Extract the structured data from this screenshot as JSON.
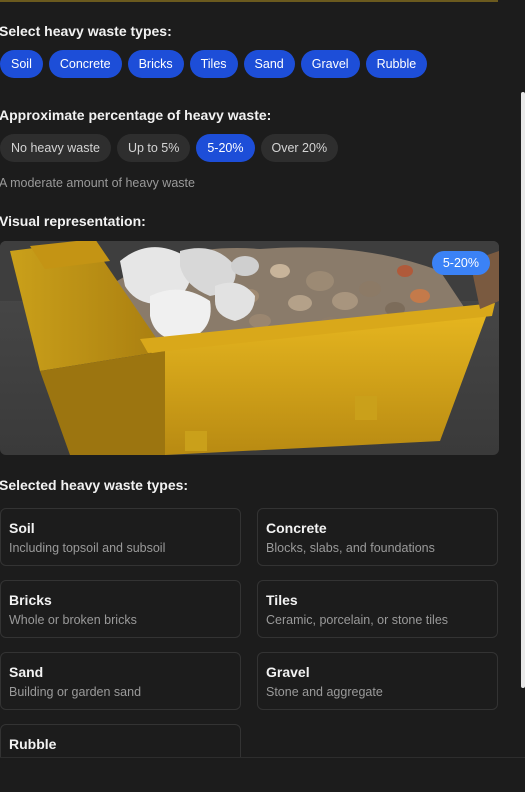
{
  "heavy_types_section": {
    "title": "Select heavy waste types:",
    "chips": [
      "Soil",
      "Concrete",
      "Bricks",
      "Tiles",
      "Sand",
      "Gravel",
      "Rubble"
    ]
  },
  "percentage_section": {
    "title": "Approximate percentage of heavy waste:",
    "options": [
      "No heavy waste",
      "Up to 5%",
      "5-20%",
      "Over 20%"
    ],
    "selected": "5-20%",
    "description": "A moderate amount of heavy waste"
  },
  "visual_section": {
    "title": "Visual representation:",
    "badge": "5-20%"
  },
  "selected_section": {
    "title": "Selected heavy waste types:",
    "cards": [
      {
        "title": "Soil",
        "desc": "Including topsoil and subsoil"
      },
      {
        "title": "Concrete",
        "desc": "Blocks, slabs, and foundations"
      },
      {
        "title": "Bricks",
        "desc": "Whole or broken bricks"
      },
      {
        "title": "Tiles",
        "desc": "Ceramic, porcelain, or stone tiles"
      },
      {
        "title": "Sand",
        "desc": "Building or garden sand"
      },
      {
        "title": "Gravel",
        "desc": "Stone and aggregate"
      },
      {
        "title": "Rubble",
        "desc": ""
      }
    ]
  },
  "colors": {
    "background": "#1c1c1c",
    "accent_blue": "#1d4ed8",
    "badge_blue": "#3b82f6",
    "chip_dark": "#2e2e2e",
    "skip_yellow": "#e0b21c"
  }
}
